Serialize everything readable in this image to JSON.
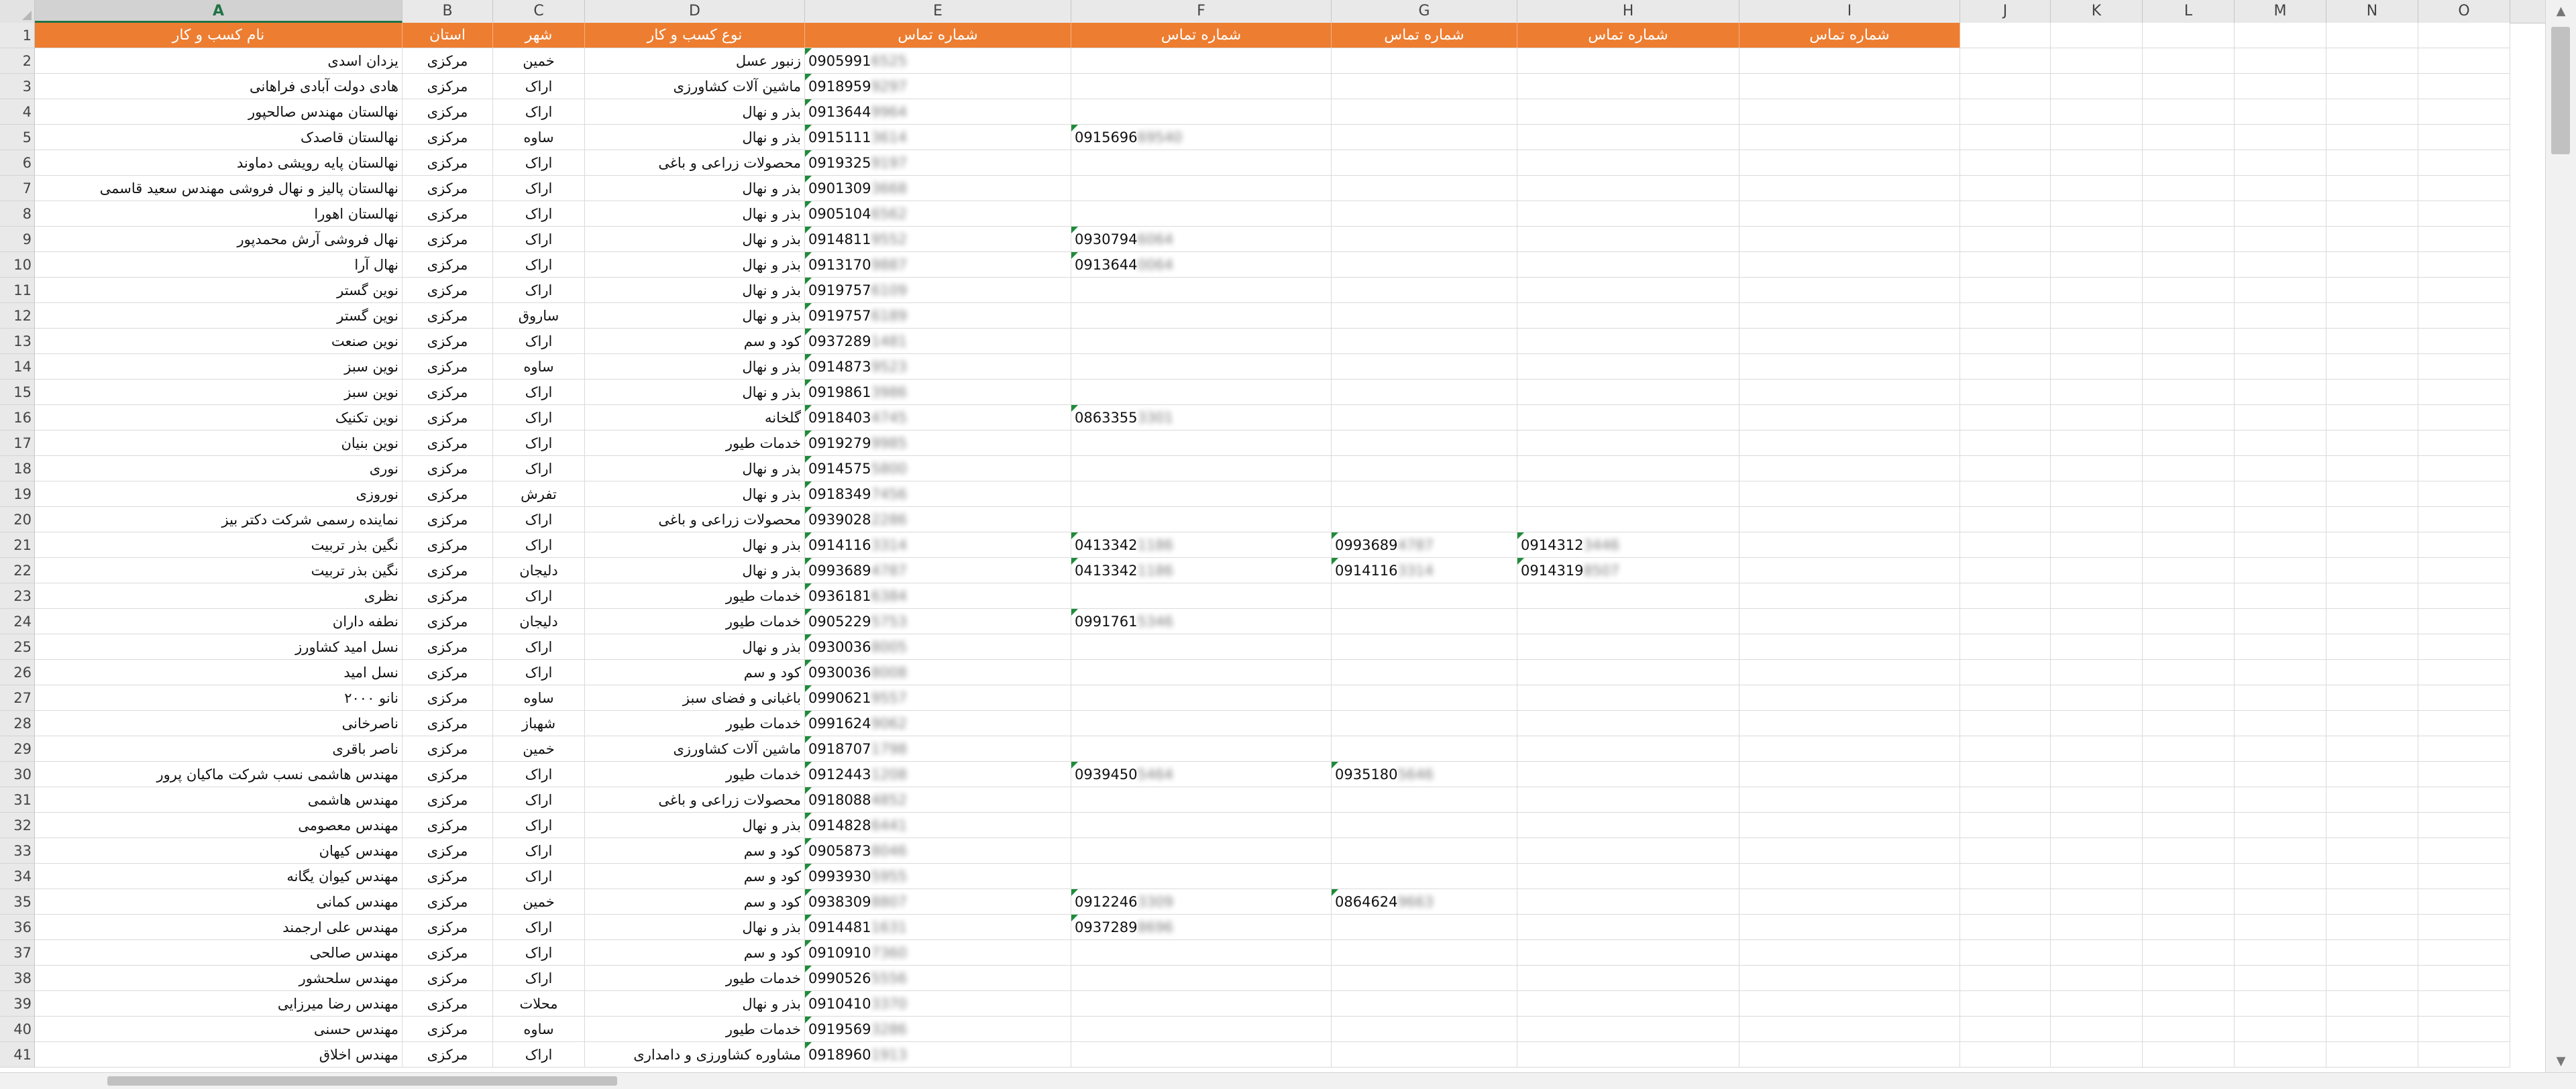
{
  "columns": [
    "A",
    "B",
    "C",
    "D",
    "E",
    "F",
    "G",
    "H",
    "I",
    "J",
    "K",
    "L",
    "M",
    "N",
    "O"
  ],
  "selected_column": "A",
  "header": {
    "A": "نام کسب و کار",
    "B": "استان",
    "C": "شهر",
    "D": "نوع کسب و کار",
    "E": "شماره تماس",
    "F": "شماره تماس",
    "G": "شماره تماس",
    "H": "شماره تماس",
    "I": "شماره تماس"
  },
  "rows": [
    {
      "n": "2",
      "a": "یزدان اسدی",
      "b": "مرکزی",
      "c": "خمین",
      "d": "زنبور عسل",
      "e": "0905991",
      "e_blur": "6525"
    },
    {
      "n": "3",
      "a": "هادی دولت آبادی فراهانی",
      "b": "مرکزی",
      "c": "اراک",
      "d": "ماشین آلات کشاورزی",
      "e": "0918959",
      "e_blur": "9297"
    },
    {
      "n": "4",
      "a": "نهالستان مهندس صالحپور",
      "b": "مرکزی",
      "c": "اراک",
      "d": "بذر و نهال",
      "e": "0913644",
      "e_blur": "9964"
    },
    {
      "n": "5",
      "a": "نهالستان قاصدک",
      "b": "مرکزی",
      "c": "ساوه",
      "d": "بذر و نهال",
      "e": "0915111",
      "e_blur": "3614",
      "f": "0915696",
      "f_blur": "69540"
    },
    {
      "n": "6",
      "a": "نهالستان پایه رویشی دماوند",
      "b": "مرکزی",
      "c": "اراک",
      "d": "محصولات زراعی و باغی",
      "e": "0919325",
      "e_blur": "9197"
    },
    {
      "n": "7",
      "a": "نهالستان پالیز و نهال فروشی مهندس سعید قاسمی",
      "b": "مرکزی",
      "c": "اراک",
      "d": "بذر و نهال",
      "e": "0901309",
      "e_blur": "3668"
    },
    {
      "n": "8",
      "a": "نهالستان اهورا",
      "b": "مرکزی",
      "c": "اراک",
      "d": "بذر و نهال",
      "e": "0905104",
      "e_blur": "6562"
    },
    {
      "n": "9",
      "a": "نهال فروشی آرش محمدپور",
      "b": "مرکزی",
      "c": "اراک",
      "d": "بذر و نهال",
      "e": "0914811",
      "e_blur": "9552",
      "f": "0930794",
      "f_blur": "6064"
    },
    {
      "n": "10",
      "a": "نهال آرا",
      "b": "مرکزی",
      "c": "اراک",
      "d": "بذر و نهال",
      "e": "0913170",
      "e_blur": "9887",
      "f": "0913644",
      "f_blur": "0064"
    },
    {
      "n": "11",
      "a": "نوین گستر",
      "b": "مرکزی",
      "c": "اراک",
      "d": "بذر و نهال",
      "e": "0919757",
      "e_blur": "6109"
    },
    {
      "n": "12",
      "a": "نوین گستر",
      "b": "مرکزی",
      "c": "ساروق",
      "d": "بذر و نهال",
      "e": "0919757",
      "e_blur": "6189"
    },
    {
      "n": "13",
      "a": "نوین صنعت",
      "b": "مرکزی",
      "c": "اراک",
      "d": "کود و سم",
      "e": "0937289",
      "e_blur": "1481"
    },
    {
      "n": "14",
      "a": "نوین سبز",
      "b": "مرکزی",
      "c": "ساوه",
      "d": "بذر و نهال",
      "e": "0914873",
      "e_blur": "9523"
    },
    {
      "n": "15",
      "a": "نوین سبز",
      "b": "مرکزی",
      "c": "اراک",
      "d": "بذر و نهال",
      "e": "0919861",
      "e_blur": "3986"
    },
    {
      "n": "16",
      "a": "نوین تکنیک",
      "b": "مرکزی",
      "c": "اراک",
      "d": "گلخانه",
      "e": "0918403",
      "e_blur": "4745",
      "f": "0863355",
      "f_blur": "3301"
    },
    {
      "n": "17",
      "a": "نوین بنیان",
      "b": "مرکزی",
      "c": "اراک",
      "d": "خدمات طیور",
      "e": "0919279",
      "e_blur": "9985"
    },
    {
      "n": "18",
      "a": "نوری",
      "b": "مرکزی",
      "c": "اراک",
      "d": "بذر و نهال",
      "e": "0914575",
      "e_blur": "5800"
    },
    {
      "n": "19",
      "a": "نوروزی",
      "b": "مرکزی",
      "c": "تفرش",
      "d": "بذر و نهال",
      "e": "0918349",
      "e_blur": "7456"
    },
    {
      "n": "20",
      "a": "نماینده رسمی شرکت دکتر بیز",
      "b": "مرکزی",
      "c": "اراک",
      "d": "محصولات زراعی و باغی",
      "e": "0939028",
      "e_blur": "2286"
    },
    {
      "n": "21",
      "a": "نگین بذر تربیت",
      "b": "مرکزی",
      "c": "اراک",
      "d": "بذر و نهال",
      "e": "0914116",
      "e_blur": "3314",
      "f": "0413342",
      "f_blur": "1186",
      "g": "0993689",
      "g_blur": "4787",
      "h": "0914312",
      "h_blur": "3446"
    },
    {
      "n": "22",
      "a": "نگین بذر تربیت",
      "b": "مرکزی",
      "c": "دلیجان",
      "d": "بذر و نهال",
      "e": "0993689",
      "e_blur": "4787",
      "f": "0413342",
      "f_blur": "1186",
      "g": "0914116",
      "g_blur": "3314",
      "h": "0914319",
      "h_blur": "8507"
    },
    {
      "n": "23",
      "a": "نظری",
      "b": "مرکزی",
      "c": "اراک",
      "d": "خدمات طیور",
      "e": "0936181",
      "e_blur": "6384"
    },
    {
      "n": "24",
      "a": "نطفه داران",
      "b": "مرکزی",
      "c": "دلیجان",
      "d": "خدمات طیور",
      "e": "0905229",
      "e_blur": "5753",
      "f": "0991761",
      "f_blur": "5346"
    },
    {
      "n": "25",
      "a": "نسل امید کشاورز",
      "b": "مرکزی",
      "c": "اراک",
      "d": "بذر و نهال",
      "e": "0930036",
      "e_blur": "8005"
    },
    {
      "n": "26",
      "a": "نسل امید",
      "b": "مرکزی",
      "c": "اراک",
      "d": "کود و سم",
      "e": "0930036",
      "e_blur": "8008"
    },
    {
      "n": "27",
      "a": "نانو ۲۰۰۰",
      "b": "مرکزی",
      "c": "ساوه",
      "d": "باغبانی و فضای سبز",
      "e": "0990621",
      "e_blur": "9557"
    },
    {
      "n": "28",
      "a": "ناصرخانی",
      "b": "مرکزی",
      "c": "شهباز",
      "d": "خدمات طیور",
      "e": "0991624",
      "e_blur": "9062"
    },
    {
      "n": "29",
      "a": "ناصر باقری",
      "b": "مرکزی",
      "c": "خمین",
      "d": "ماشین آلات کشاورزی",
      "e": "0918707",
      "e_blur": "1798"
    },
    {
      "n": "30",
      "a": "مهندس هاشمی نسب شرکت ماکیان پرور",
      "b": "مرکزی",
      "c": "اراک",
      "d": "خدمات طیور",
      "e": "0912443",
      "e_blur": "1208",
      "f": "0939450",
      "f_blur": "5464",
      "g": "0935180",
      "g_blur": "5646"
    },
    {
      "n": "31",
      "a": "مهندس هاشمی",
      "b": "مرکزی",
      "c": "اراک",
      "d": "محصولات زراعی و باغی",
      "e": "0918088",
      "e_blur": "4852"
    },
    {
      "n": "32",
      "a": "مهندس معصومی",
      "b": "مرکزی",
      "c": "اراک",
      "d": "بذر و نهال",
      "e": "0914828",
      "e_blur": "6441"
    },
    {
      "n": "33",
      "a": "مهندس کیهان",
      "b": "مرکزی",
      "c": "اراک",
      "d": "کود و سم",
      "e": "0905873",
      "e_blur": "8046"
    },
    {
      "n": "34",
      "a": "مهندس کیوان یگانه",
      "b": "مرکزی",
      "c": "اراک",
      "d": "کود و سم",
      "e": "0993930",
      "e_blur": "5955"
    },
    {
      "n": "35",
      "a": "مهندس کمانی",
      "b": "مرکزی",
      "c": "خمین",
      "d": "کود و سم",
      "e": "0938309",
      "e_blur": "8807",
      "f": "0912246",
      "f_blur": "3309",
      "g": "0864624",
      "g_blur": "9663"
    },
    {
      "n": "36",
      "a": "مهندس علی ارجمند",
      "b": "مرکزی",
      "c": "اراک",
      "d": "بذر و نهال",
      "e": "0914481",
      "e_blur": "1631",
      "f": "0937289",
      "f_blur": "8696"
    },
    {
      "n": "37",
      "a": "مهندس صالحی",
      "b": "مرکزی",
      "c": "اراک",
      "d": "کود و سم",
      "e": "0910910",
      "e_blur": "7360"
    },
    {
      "n": "38",
      "a": "مهندس سلحشور",
      "b": "مرکزی",
      "c": "اراک",
      "d": "خدمات طیور",
      "e": "0990526",
      "e_blur": "5556"
    },
    {
      "n": "39",
      "a": "مهندس رضا میرزایی",
      "b": "مرکزی",
      "c": "محلات",
      "d": "بذر و نهال",
      "e": "0910410",
      "e_blur": "3370"
    },
    {
      "n": "40",
      "a": "مهندس حسنی",
      "b": "مرکزی",
      "c": "ساوه",
      "d": "خدمات طیور",
      "e": "0919569",
      "e_blur": "3286"
    },
    {
      "n": "41",
      "a": "مهندس اخلاق",
      "b": "مرکزی",
      "c": "اراک",
      "d": "مشاوره کشاورزی و دامداری",
      "e": "0918960",
      "e_blur": "1913"
    }
  ]
}
